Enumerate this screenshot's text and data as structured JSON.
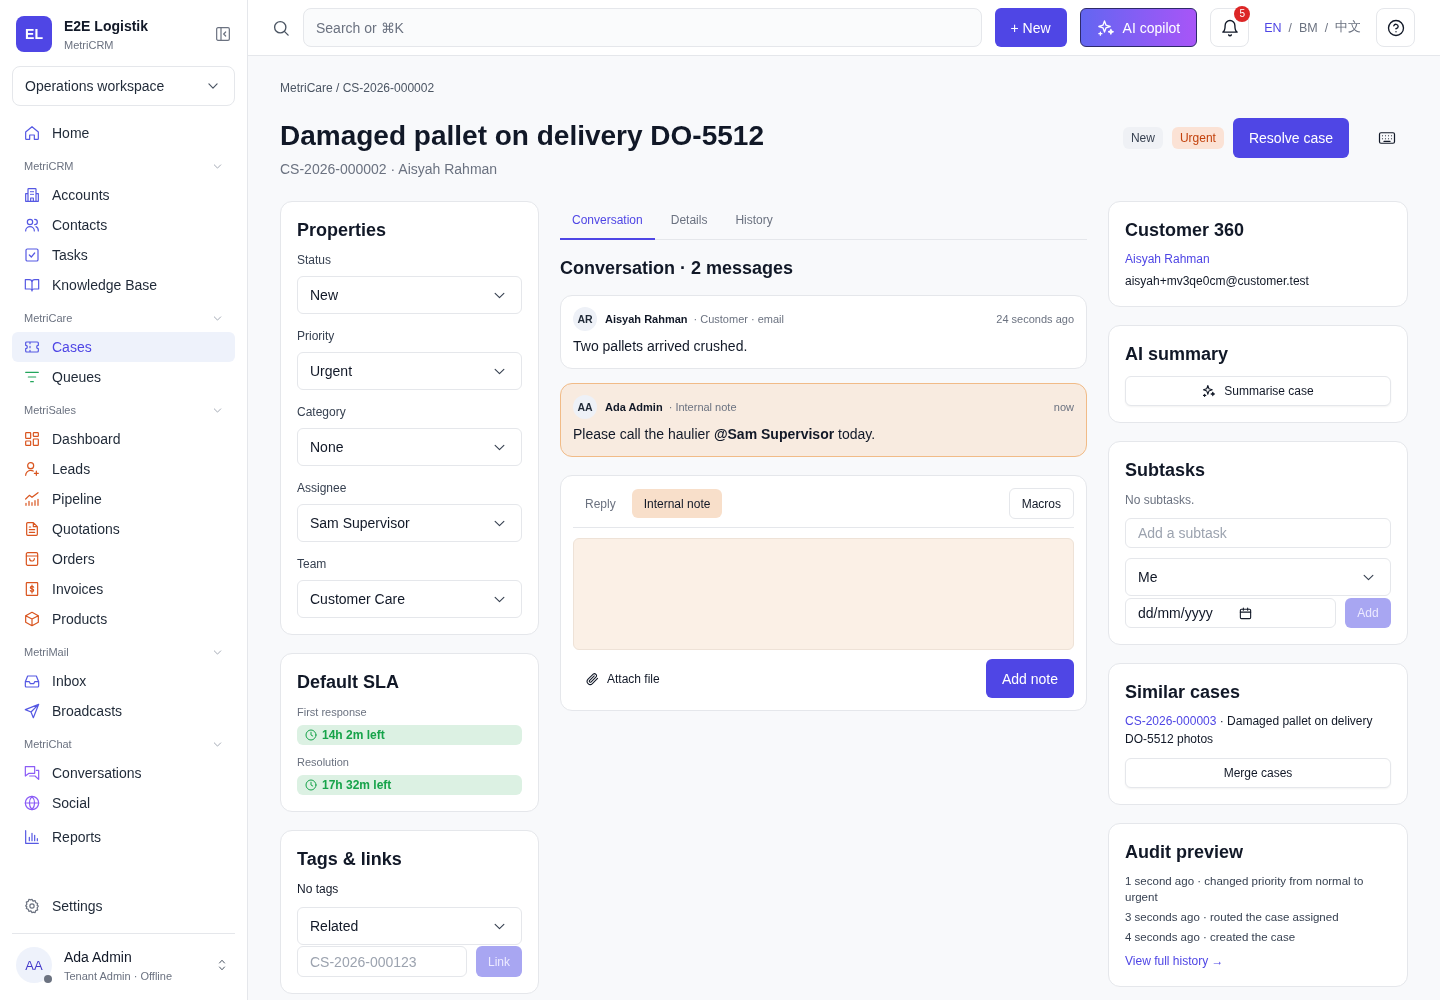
{
  "sidebar": {
    "brand": {
      "initials": "EL",
      "name": "E2E Logistik",
      "product": "MetriCRM"
    },
    "workspace": {
      "value": "Operations workspace"
    },
    "groups": [
      {
        "items": [
          {
            "label": "Home",
            "selected": false
          }
        ]
      },
      {
        "label": "MetriCRM",
        "expanded": true,
        "items": [
          {
            "label": "Accounts",
            "selected": false
          },
          {
            "label": "Contacts",
            "selected": false
          },
          {
            "label": "Tasks",
            "selected": false
          },
          {
            "label": "Knowledge Base",
            "selected": false
          }
        ]
      },
      {
        "label": "MetriCare",
        "expanded": true,
        "items": [
          {
            "label": "Cases",
            "selected": true
          },
          {
            "label": "Queues",
            "selected": false
          }
        ]
      },
      {
        "label": "MetriSales",
        "expanded": true,
        "items": [
          {
            "label": "Dashboard",
            "selected": false
          },
          {
            "label": "Leads",
            "selected": false
          },
          {
            "label": "Pipeline",
            "selected": false
          },
          {
            "label": "Quotations",
            "selected": false
          },
          {
            "label": "Orders",
            "selected": false
          },
          {
            "label": "Invoices",
            "selected": false
          },
          {
            "label": "Products",
            "selected": false
          }
        ]
      },
      {
        "label": "MetriMail",
        "expanded": true,
        "items": [
          {
            "label": "Inbox",
            "selected": false
          },
          {
            "label": "Broadcasts",
            "selected": false
          }
        ]
      },
      {
        "label": "MetriChat",
        "expanded": true,
        "items": [
          {
            "label": "Conversations",
            "selected": false
          },
          {
            "label": "Social",
            "selected": false
          }
        ]
      },
      {
        "items": [
          {
            "label": "Reports",
            "selected": false
          }
        ]
      }
    ],
    "settings": {
      "label": "Settings",
      "selected": false
    },
    "user": {
      "initials": "AA",
      "name": "Ada Admin",
      "role": "Tenant Admin · Offline",
      "online": false
    }
  },
  "topbar": {
    "search": {
      "placeholder": "Search or ⌘K"
    },
    "new_button": "+ New",
    "copilot_button": "AI copilot",
    "notifications": {
      "count": "5"
    },
    "languages": [
      {
        "label": "EN",
        "selected": true
      },
      {
        "label": "BM",
        "selected": false
      },
      {
        "label": "中文",
        "selected": false
      }
    ],
    "language_separator": "/"
  },
  "header": {
    "breadcrumb": "MetriCare / CS-2026-000002",
    "title": "Damaged pallet on delivery DO-5512",
    "subtitle": "CS-2026-000002 · Aisyah Rahman",
    "badges": [
      {
        "label": "New",
        "kind": "status"
      },
      {
        "label": "Urgent",
        "kind": "priority"
      }
    ],
    "primary_button": "Resolve case"
  },
  "properties": {
    "title": "Properties",
    "fields": [
      {
        "label": "Status",
        "value": "New"
      },
      {
        "label": "Priority",
        "value": "Urgent"
      },
      {
        "label": "Category",
        "value": "None"
      },
      {
        "label": "Assignee",
        "value": "Sam Supervisor"
      },
      {
        "label": "Team",
        "value": "Customer Care"
      }
    ]
  },
  "sla": {
    "title": "Default SLA",
    "timers": [
      {
        "label": "First response",
        "value": "14h 2m left"
      },
      {
        "label": "Resolution",
        "value": "17h 32m left"
      }
    ]
  },
  "tags": {
    "title": "Tags & links",
    "empty_text": "No tags",
    "relation": {
      "value": "Related"
    },
    "case_input": {
      "placeholder": "CS-2026-000123"
    },
    "link_button": {
      "label": "Link",
      "disabled": true
    }
  },
  "conversation": {
    "tabs": [
      {
        "label": "Conversation",
        "selected": true
      },
      {
        "label": "Details",
        "selected": false
      },
      {
        "label": "History",
        "selected": false
      }
    ],
    "heading": "Conversation · 2 messages",
    "messages": [
      {
        "kind": "message",
        "initials": "AR",
        "author": "Aisyah Rahman",
        "meta": "· Customer · email",
        "time": "24 seconds ago",
        "body": "Two pallets arrived crushed."
      },
      {
        "kind": "internal_note",
        "initials": "AA",
        "author": "Ada Admin",
        "meta": "· Internal note",
        "time": "now",
        "body": "Please call the haulier **@Sam Supervisor** today."
      }
    ],
    "composer": {
      "modes": [
        {
          "label": "Reply",
          "selected": false
        },
        {
          "label": "Internal note",
          "selected": true
        }
      ],
      "macros_button": "Macros",
      "attach_label": "Attach file",
      "submit_button": "Add note"
    }
  },
  "customer": {
    "title": "Customer 360",
    "name": "Aisyah Rahman",
    "email": "aisyah+mv3qe0cm@customer.test"
  },
  "ai_summary": {
    "title": "AI summary",
    "button": "Summarise case"
  },
  "subtasks": {
    "title": "Subtasks",
    "empty_text": "No subtasks.",
    "input": {
      "placeholder": "Add a subtask"
    },
    "assignee": {
      "value": "Me"
    },
    "due_date": {
      "placeholder": "dd/mm/yyyy"
    },
    "add_button": {
      "label": "Add",
      "disabled": true
    }
  },
  "similar_cases": {
    "title": "Similar cases",
    "items": [
      {
        "case_id": "CS-2026-000003",
        "text": "· Damaged pallet on delivery DO-5512 photos"
      }
    ],
    "merge_button": "Merge cases"
  },
  "audit": {
    "title": "Audit preview",
    "entries": [
      "1 second ago · changed priority from normal to urgent",
      "3 seconds ago · routed the case assigned",
      "4 seconds ago · created the case"
    ],
    "link": "View full history →"
  }
}
